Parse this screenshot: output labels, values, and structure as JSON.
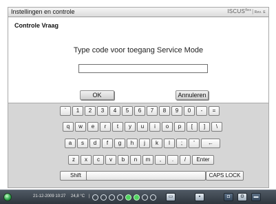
{
  "window": {
    "title": "Instellingen en controle",
    "brand": "ISCUS",
    "brand_sup": "flex",
    "rev": "Rev. E"
  },
  "dialog": {
    "heading": "Controle Vraag",
    "prompt": "Type code voor toegang Service Mode",
    "code_value": "",
    "ok_label": "OK",
    "cancel_label": "Annuleren"
  },
  "keyboard": {
    "row1": [
      "`",
      "1",
      "2",
      "3",
      "4",
      "5",
      "6",
      "7",
      "8",
      "9",
      "0",
      "-",
      "="
    ],
    "row2": [
      "q",
      "w",
      "e",
      "r",
      "t",
      "y",
      "u",
      "i",
      "o",
      "p",
      "[",
      "]",
      "\\"
    ],
    "row3": [
      "a",
      "s",
      "d",
      "f",
      "g",
      "h",
      "j",
      "k",
      "l",
      ";",
      "'",
      "←"
    ],
    "row4": [
      "z",
      "x",
      "c",
      "v",
      "b",
      "n",
      "m",
      ",",
      ".",
      "/",
      "Enter"
    ],
    "shift_label": "Shift",
    "space_label": "",
    "caps_label": "CAPS LOCK"
  },
  "taskbar": {
    "datetime": "21-12-2009 10:27",
    "temperature": "24,8 °C",
    "status_indicators": [
      false,
      false,
      false,
      false,
      true,
      true,
      false,
      false
    ],
    "icons": [
      "monitor-icon",
      "image-icon",
      "gear-icon",
      "folder-icon"
    ]
  }
}
